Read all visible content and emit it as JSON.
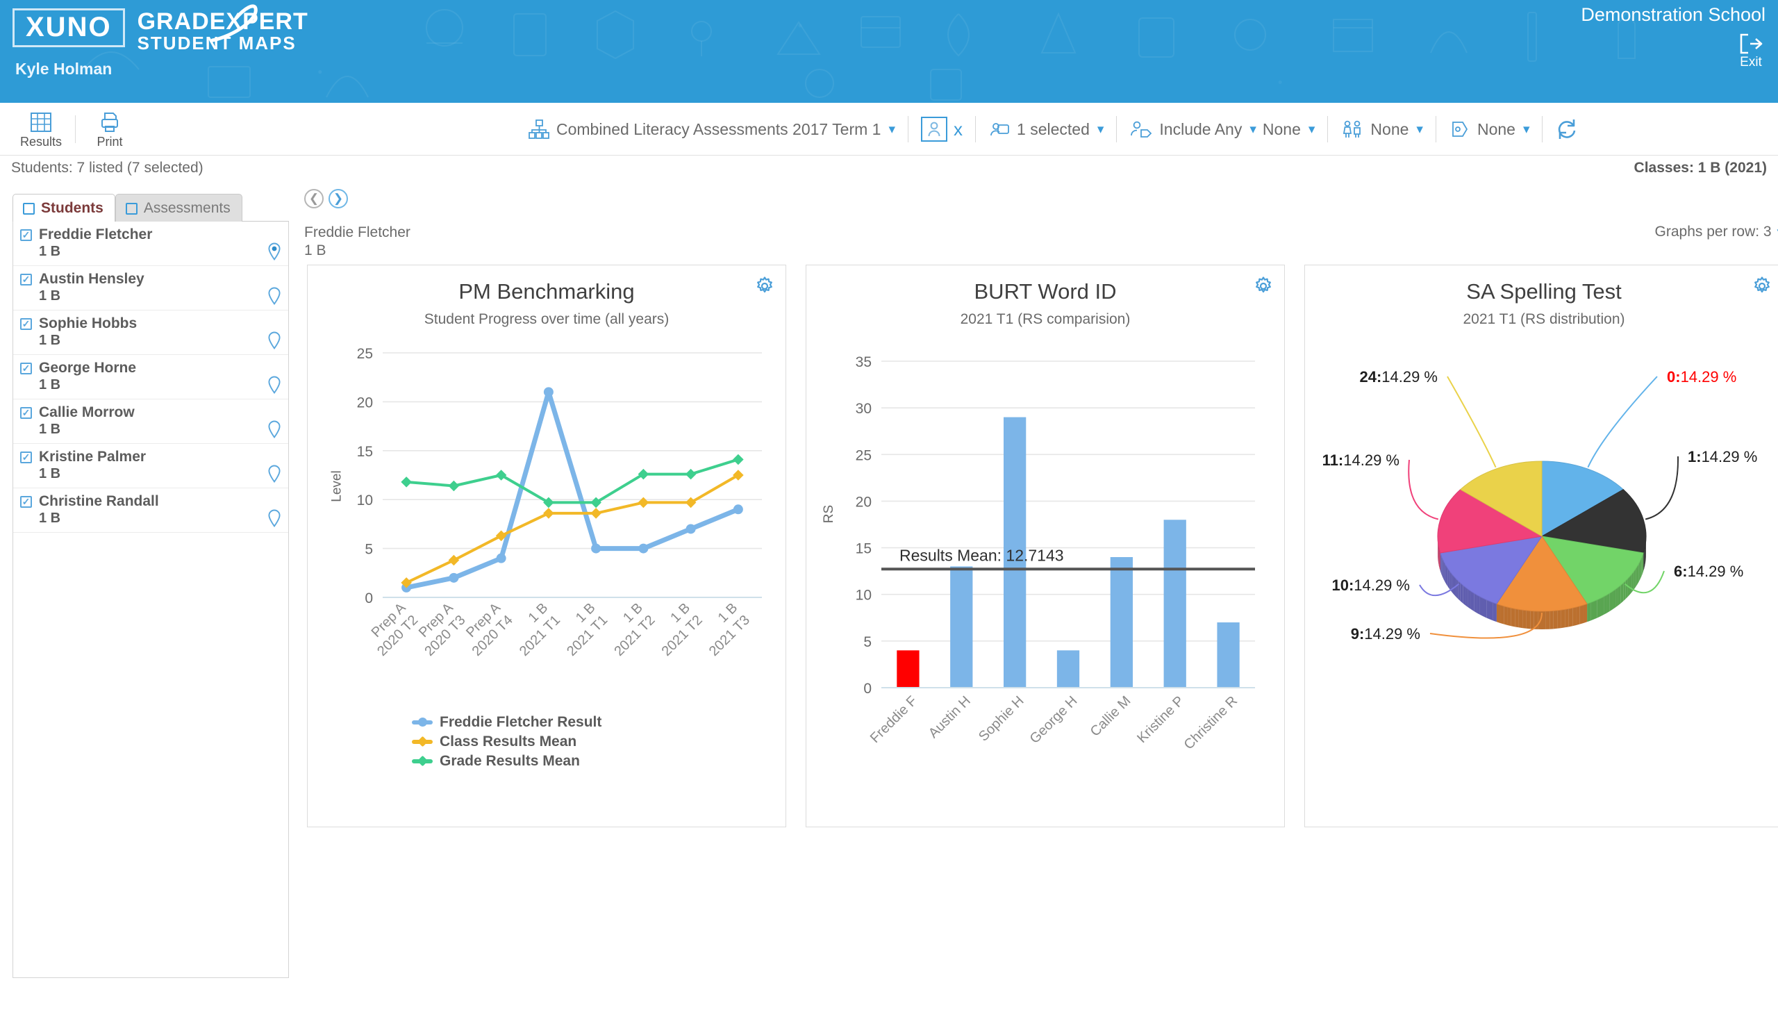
{
  "header": {
    "logo_box": "XUNO",
    "brand_line1": "GRADE",
    "brand_line1b": "PERT",
    "brand_x": "X",
    "brand_line2": "STUDENT MAPS",
    "user": "Kyle Holman",
    "school": "Demonstration School",
    "exit_label": "Exit"
  },
  "toolbar": {
    "results_label": "Results",
    "print_label": "Print",
    "assessment_set": "Combined Literacy Assessments 2017 Term 1",
    "clear_student_label": "x",
    "selected_label": "1 selected",
    "include_label": "Include Any",
    "include_value": "None",
    "gender_value": "None",
    "flag_value": "None"
  },
  "subheader": {
    "students_count": "Students: 7 listed (7 selected)",
    "classes": "Classes: 1 B (2021)"
  },
  "sidebar": {
    "tabs": [
      {
        "label": "Students",
        "active": true
      },
      {
        "label": "Assessments",
        "active": false
      }
    ],
    "students": [
      {
        "name": "Freddie Fletcher",
        "class": "1 B",
        "checked": true,
        "pin_filled": true
      },
      {
        "name": "Austin Hensley",
        "class": "1 B",
        "checked": true,
        "pin_filled": false
      },
      {
        "name": "Sophie Hobbs",
        "class": "1 B",
        "checked": true,
        "pin_filled": false
      },
      {
        "name": "George Horne",
        "class": "1 B",
        "checked": true,
        "pin_filled": false
      },
      {
        "name": "Callie Morrow",
        "class": "1 B",
        "checked": true,
        "pin_filled": false
      },
      {
        "name": "Kristine Palmer",
        "class": "1 B",
        "checked": true,
        "pin_filled": false
      },
      {
        "name": "Christine Randall",
        "class": "1 B",
        "checked": true,
        "pin_filled": false
      }
    ]
  },
  "main": {
    "current_student_name": "Freddie Fletcher",
    "current_student_class": "1 B",
    "graphs_per_row_label": "Graphs per row:",
    "graphs_per_row_value": "3"
  },
  "chart_data": [
    {
      "type": "line",
      "title": "PM Benchmarking",
      "subtitle": "Student Progress over time (all years)",
      "xlabel": "",
      "ylabel": "Level",
      "ylim": [
        0,
        25
      ],
      "yticks": [
        0,
        5,
        10,
        15,
        20,
        25
      ],
      "grid": true,
      "legend_position": "bottom-left",
      "categories": [
        "Prep A\n2020 T2",
        "Prep A\n2020 T3",
        "Prep A\n2020 T4",
        "1 B\n2021 T1",
        "1 B\n2021 T1",
        "1 B\n2021 T2",
        "1 B\n2021 T2",
        "1 B\n2021 T3"
      ],
      "series": [
        {
          "name": "Freddie Fletcher Result",
          "color": "#7cb5e8",
          "values": [
            1,
            2,
            4,
            21,
            5,
            5,
            7,
            9
          ]
        },
        {
          "name": "Class Results Mean",
          "color": "#f2b827",
          "values": [
            1.5,
            3.8,
            6.3,
            8.6,
            8.6,
            9.7,
            9.7,
            12.5
          ]
        },
        {
          "name": "Grade Results Mean",
          "color": "#3ecf8e",
          "values": [
            11.8,
            11.4,
            12.5,
            9.7,
            9.7,
            12.6,
            12.6,
            14.1
          ]
        }
      ]
    },
    {
      "type": "bar",
      "title": "BURT Word ID",
      "subtitle": "2021 T1 (RS comparision)",
      "xlabel": "",
      "ylabel": "RS",
      "ylim": [
        0,
        35
      ],
      "yticks": [
        0,
        5,
        10,
        15,
        20,
        25,
        30,
        35
      ],
      "grid": true,
      "categories": [
        "Freddie F",
        "Austin H",
        "Sophie H",
        "George H",
        "Callie M",
        "Kristine P",
        "Christine R"
      ],
      "values": [
        4,
        13,
        29,
        4,
        14,
        18,
        7
      ],
      "bar_colors": [
        "#ff0000",
        "#7cb5e8",
        "#7cb5e8",
        "#7cb5e8",
        "#7cb5e8",
        "#7cb5e8",
        "#7cb5e8"
      ],
      "mean_line": {
        "label": "Results Mean: 12.7143",
        "value": 12.7143,
        "color": "#555555"
      }
    },
    {
      "type": "pie",
      "title": "SA Spelling Test",
      "subtitle": "2021 T1 (RS distribution)",
      "labels": [
        "0",
        "1",
        "6",
        "9",
        "10",
        "11",
        "24"
      ],
      "percents": [
        "14.29 %",
        "14.29 %",
        "14.29 %",
        "14.29 %",
        "14.29 %",
        "14.29 %",
        "14.29 %"
      ],
      "values": [
        14.29,
        14.29,
        14.29,
        14.29,
        14.29,
        14.29,
        14.29
      ],
      "colors": [
        "#62b3ea",
        "#333333",
        "#72d468",
        "#f0903c",
        "#7b79e0",
        "#f0417a",
        "#ead24a"
      ],
      "highlight_index": 0,
      "highlight_color": "#ff0000"
    }
  ]
}
